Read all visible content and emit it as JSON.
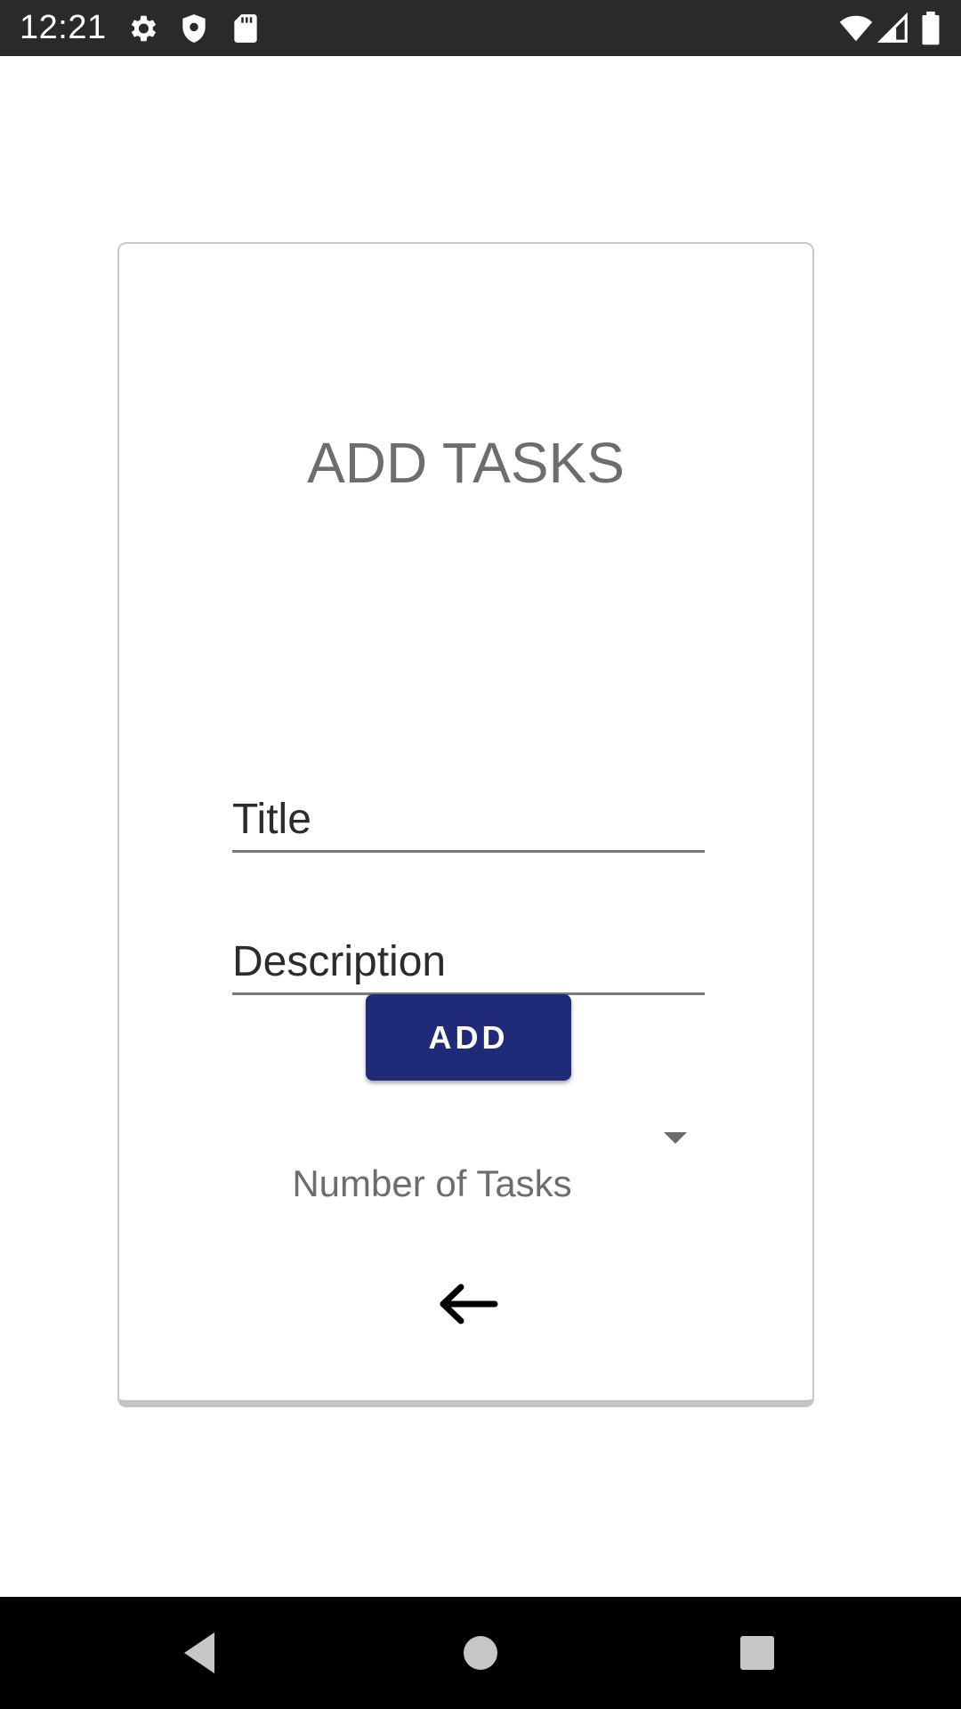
{
  "status_bar": {
    "time": "12:21",
    "left_icons": [
      "gear-icon",
      "shield-icon",
      "sd-card-icon"
    ],
    "right_icons": [
      "wifi-icon",
      "cell-signal-icon",
      "battery-icon"
    ]
  },
  "form": {
    "heading": "ADD TASKS",
    "title_field": {
      "placeholder": "Title",
      "value": ""
    },
    "description_field": {
      "placeholder": "Description",
      "value": ""
    },
    "spinner": {
      "selected": "",
      "icon": "dropdown-arrow-icon"
    },
    "add_button_label": "ADD",
    "task_count_label": "Number of Tasks",
    "back_icon": "arrow-left-icon"
  },
  "nav_bar": {
    "buttons": [
      "back-triangle-icon",
      "home-circle-icon",
      "recents-square-icon"
    ]
  },
  "colors": {
    "status_bar": "#2a2a2b",
    "accent_button": "#1f2a78",
    "heading_text": "#6d6d6d",
    "nav_bar": "#000000"
  }
}
